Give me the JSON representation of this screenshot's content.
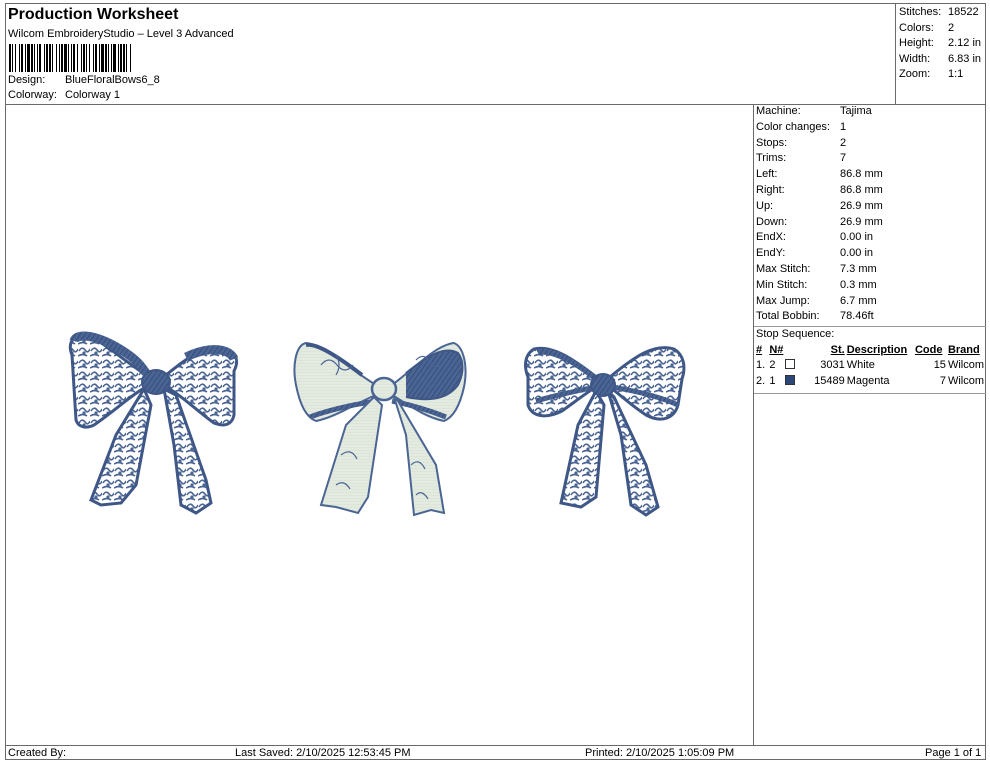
{
  "header": {
    "title": "Production Worksheet",
    "software": "Wilcom EmbroideryStudio – Level 3 Advanced",
    "design_label": "Design:",
    "design_value": "BlueFloralBows6_8",
    "colorway_label": "Colorway:",
    "colorway_value": "Colorway 1"
  },
  "summary": [
    {
      "label": "Stitches:",
      "value": "18522"
    },
    {
      "label": "Colors:",
      "value": "2"
    },
    {
      "label": "Height:",
      "value": "2.12 in"
    },
    {
      "label": "Width:",
      "value": "6.83 in"
    },
    {
      "label": "Zoom:",
      "value": "1:1"
    }
  ],
  "machine_info": [
    {
      "label": "Machine:",
      "value": "Tajima"
    },
    {
      "label": "Color changes:",
      "value": "1"
    },
    {
      "label": "Stops:",
      "value": "2"
    },
    {
      "label": "Trims:",
      "value": "7"
    },
    {
      "label": "Left:",
      "value": "86.8 mm"
    },
    {
      "label": "Right:",
      "value": "86.8 mm"
    },
    {
      "label": "Up:",
      "value": "26.9 mm"
    },
    {
      "label": "Down:",
      "value": "26.9 mm"
    },
    {
      "label": "EndX:",
      "value": "0.00 in"
    },
    {
      "label": "EndY:",
      "value": "0.00 in"
    },
    {
      "label": "Max Stitch:",
      "value": "7.3 mm"
    },
    {
      "label": "Min Stitch:",
      "value": "0.3 mm"
    },
    {
      "label": "Max Jump:",
      "value": "6.7 mm"
    },
    {
      "label": "Total Bobbin:",
      "value": "78.46ft"
    }
  ],
  "stop_sequence": {
    "title": "Stop Sequence:",
    "columns": [
      "#",
      "N#",
      "St.",
      "Description",
      "Code",
      "Brand"
    ],
    "rows": [
      {
        "index": "1.",
        "needle": "2",
        "swatch": "#ffffff",
        "stitches": "3031",
        "description": "White",
        "code": "15",
        "brand": "Wilcom"
      },
      {
        "index": "2.",
        "needle": "1",
        "swatch": "#2c4777",
        "stitches": "15489",
        "description": "Magenta",
        "code": "7",
        "brand": "Wilcom"
      }
    ]
  },
  "colors": {
    "thread_blue": "#4a6494",
    "thread_white": "#e3ebe0",
    "border": "#6a6a6a"
  },
  "footer": {
    "created_by": "Created By:",
    "last_saved": "Last Saved: 2/10/2025 12:53:45 PM",
    "printed": "Printed: 2/10/2025 1:05:09 PM",
    "page": "Page 1 of 1"
  }
}
